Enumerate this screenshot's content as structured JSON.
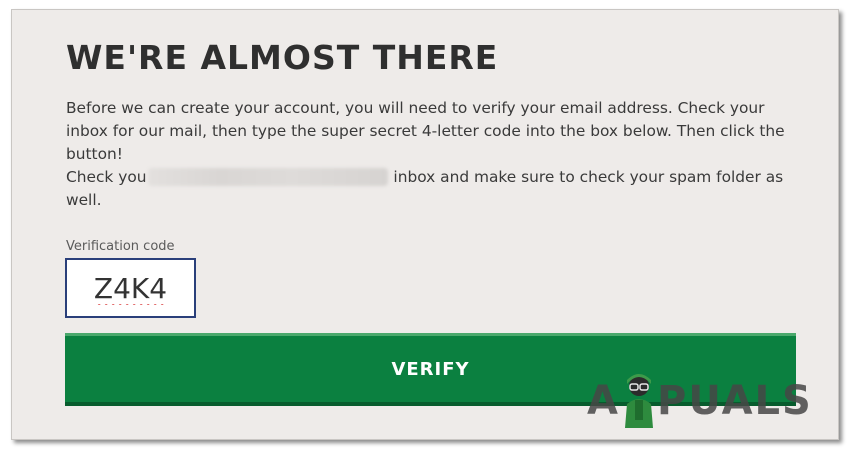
{
  "page": {
    "title": "WE'RE ALMOST THERE",
    "paragraph1": "Before we can create your account, you will need to verify your email address. Check your inbox for our mail, then type the super secret 4-letter code into the box below. Then click the button!",
    "paragraph2_before": "Check you",
    "paragraph2_after": "inbox and make sure to check your spam folder as well."
  },
  "form": {
    "code_label": "Verification code",
    "code_value": "Z4K4",
    "verify_label": "VERIFY"
  },
  "watermark": {
    "text": "APPUALS",
    "visible_left": "A",
    "visible_right": "PUALS"
  },
  "colors": {
    "card_bg": "#eeebe9",
    "button": "#0b8040",
    "input_border": "#2a3f7a",
    "title": "#2f2f2f"
  }
}
